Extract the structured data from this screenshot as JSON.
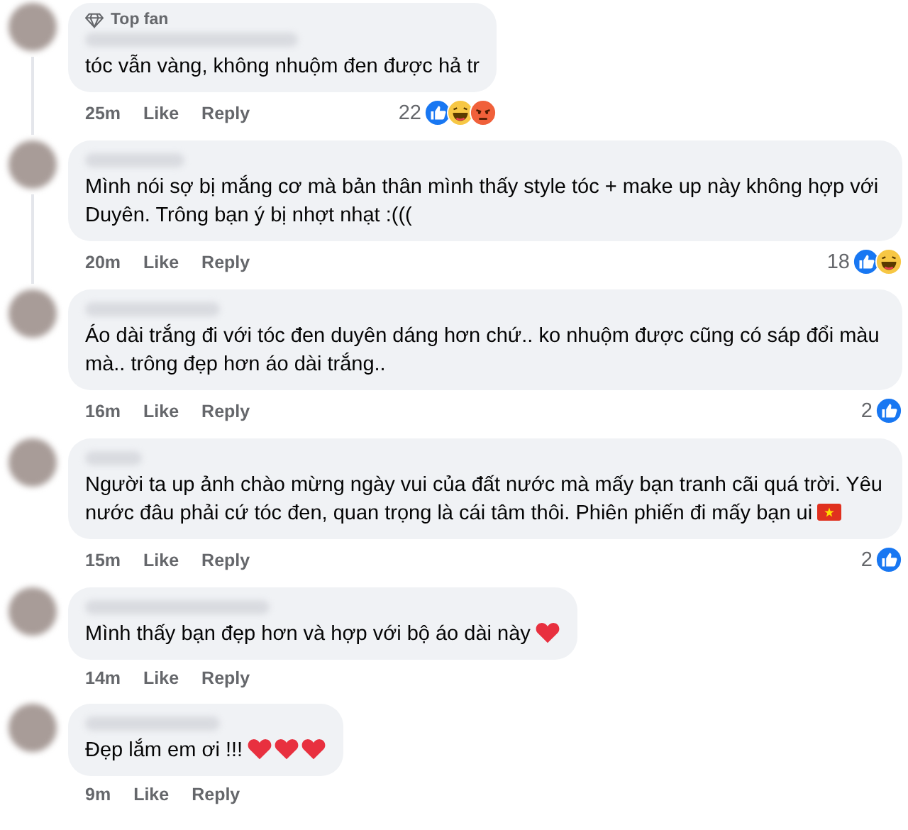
{
  "comments": [
    {
      "badge": "Top fan",
      "thread_line": true,
      "text": "tóc vẫn vàng, không nhuộm đen được hả tr",
      "time": "25m",
      "like": "Like",
      "reply": "Reply",
      "reaction_count": "22",
      "reactions": [
        {
          "kind": "like"
        },
        {
          "kind": "haha"
        },
        {
          "kind": "angry"
        }
      ]
    },
    {
      "thread_line": true,
      "text": "Mình nói sợ bị mắng cơ mà bản thân mình thấy style tóc + make up này không hợp với Duyên. Trông bạn ý bị nhợt nhạt :(((",
      "time": "20m",
      "like": "Like",
      "reply": "Reply",
      "reaction_count": "18",
      "reactions": [
        {
          "kind": "like"
        },
        {
          "kind": "haha"
        }
      ]
    },
    {
      "thread_line": false,
      "text": "Áo dài trắng đi với tóc đen duyên dáng hơn chứ.. ko nhuộm được cũng có sáp đổi màu mà.. trông đẹp hơn áo dài trắng..",
      "time": "16m",
      "like": "Like",
      "reply": "Reply",
      "reaction_count": "2",
      "reactions": [
        {
          "kind": "like"
        }
      ]
    },
    {
      "thread_line": false,
      "text": "Người ta up ảnh chào mừng ngày vui của đất nước mà mấy bạn tranh cãi quá trời. Yêu nước đâu phải cứ tóc đen, quan trọng là cái tâm thôi. Phiên phiến đi mấy bạn ui",
      "emojis": [
        {
          "kind": "flag"
        }
      ],
      "time": "15m",
      "like": "Like",
      "reply": "Reply",
      "reaction_count": "2",
      "reactions": [
        {
          "kind": "like"
        }
      ]
    },
    {
      "thread_line": false,
      "text": "Mình thấy bạn đẹp hơn và hợp với bộ áo dài này",
      "emojis": [
        {
          "kind": "heart"
        }
      ],
      "time": "14m",
      "like": "Like",
      "reply": "Reply"
    },
    {
      "thread_line": false,
      "text": "Đẹp lắm em ơi !!!",
      "emojis": [
        {
          "kind": "heart"
        },
        {
          "kind": "heart"
        },
        {
          "kind": "heart"
        }
      ],
      "time": "9m",
      "like": "Like",
      "reply": "Reply"
    }
  ]
}
